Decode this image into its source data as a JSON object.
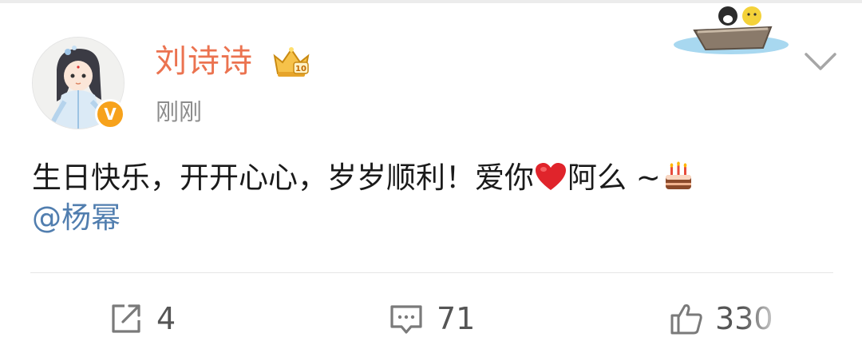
{
  "post": {
    "author": "刘诗诗",
    "timestamp": "刚刚",
    "verified_badge": "V",
    "text_line1": "生日快乐，开开心心，岁岁顺利！爱你",
    "text_after_heart": "阿么 ~",
    "mention": "@杨幂",
    "emojis": [
      "heart-emoji",
      "cake-emoji"
    ]
  },
  "actions": {
    "repost_count": "4",
    "comment_count": "71",
    "like_count": "330"
  },
  "colors": {
    "username": "#eb7350",
    "mention": "#517eaf",
    "badge": "#f7a21b",
    "muted": "#8c8c8c"
  },
  "icons": {
    "repost": "share-icon",
    "comment": "comment-icon",
    "like": "thumbs-up-icon",
    "menu": "chevron-down-icon",
    "member": "crown-icon"
  }
}
